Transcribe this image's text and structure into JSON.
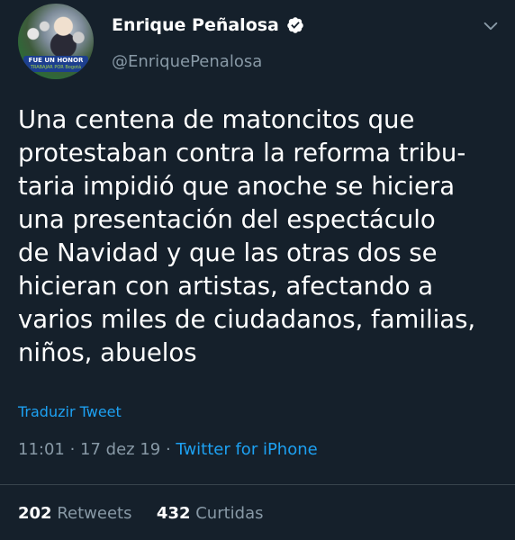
{
  "author": {
    "display_name": "Enrique Peñalosa",
    "handle": "@EnriquePenalosa",
    "verified": true,
    "avatar_badge_line1": "FUE UN HONOR",
    "avatar_badge_line2": "TRABAJAR POR Bogotá"
  },
  "tweet": {
    "lines": [
      "Una centena de matoncitos que",
      "protestaban contra la reforma tribu-",
      "taria impidió que anoche se hiciera",
      "una presentación del espectáculo",
      "de Navidad y que las otras dos se",
      "hicieran con artistas, afectando a",
      "varios miles de ciudadanos, familias,",
      "niños, abuelos"
    ],
    "translate_label": "Traduzir Tweet",
    "time": "11:01",
    "separator": " · ",
    "date": "17 dez 19",
    "source": "Twitter for iPhone"
  },
  "stats": {
    "retweets_count": "202",
    "retweets_label": "Retweets",
    "likes_count": "432",
    "likes_label": "Curtidas"
  },
  "colors": {
    "background": "#15202b",
    "text_primary": "#ffffff",
    "text_secondary": "#8899a6",
    "accent": "#1da1f2",
    "divider": "#38444d"
  },
  "icons": {
    "verified": "verified-badge-icon",
    "menu": "chevron-down-icon"
  }
}
